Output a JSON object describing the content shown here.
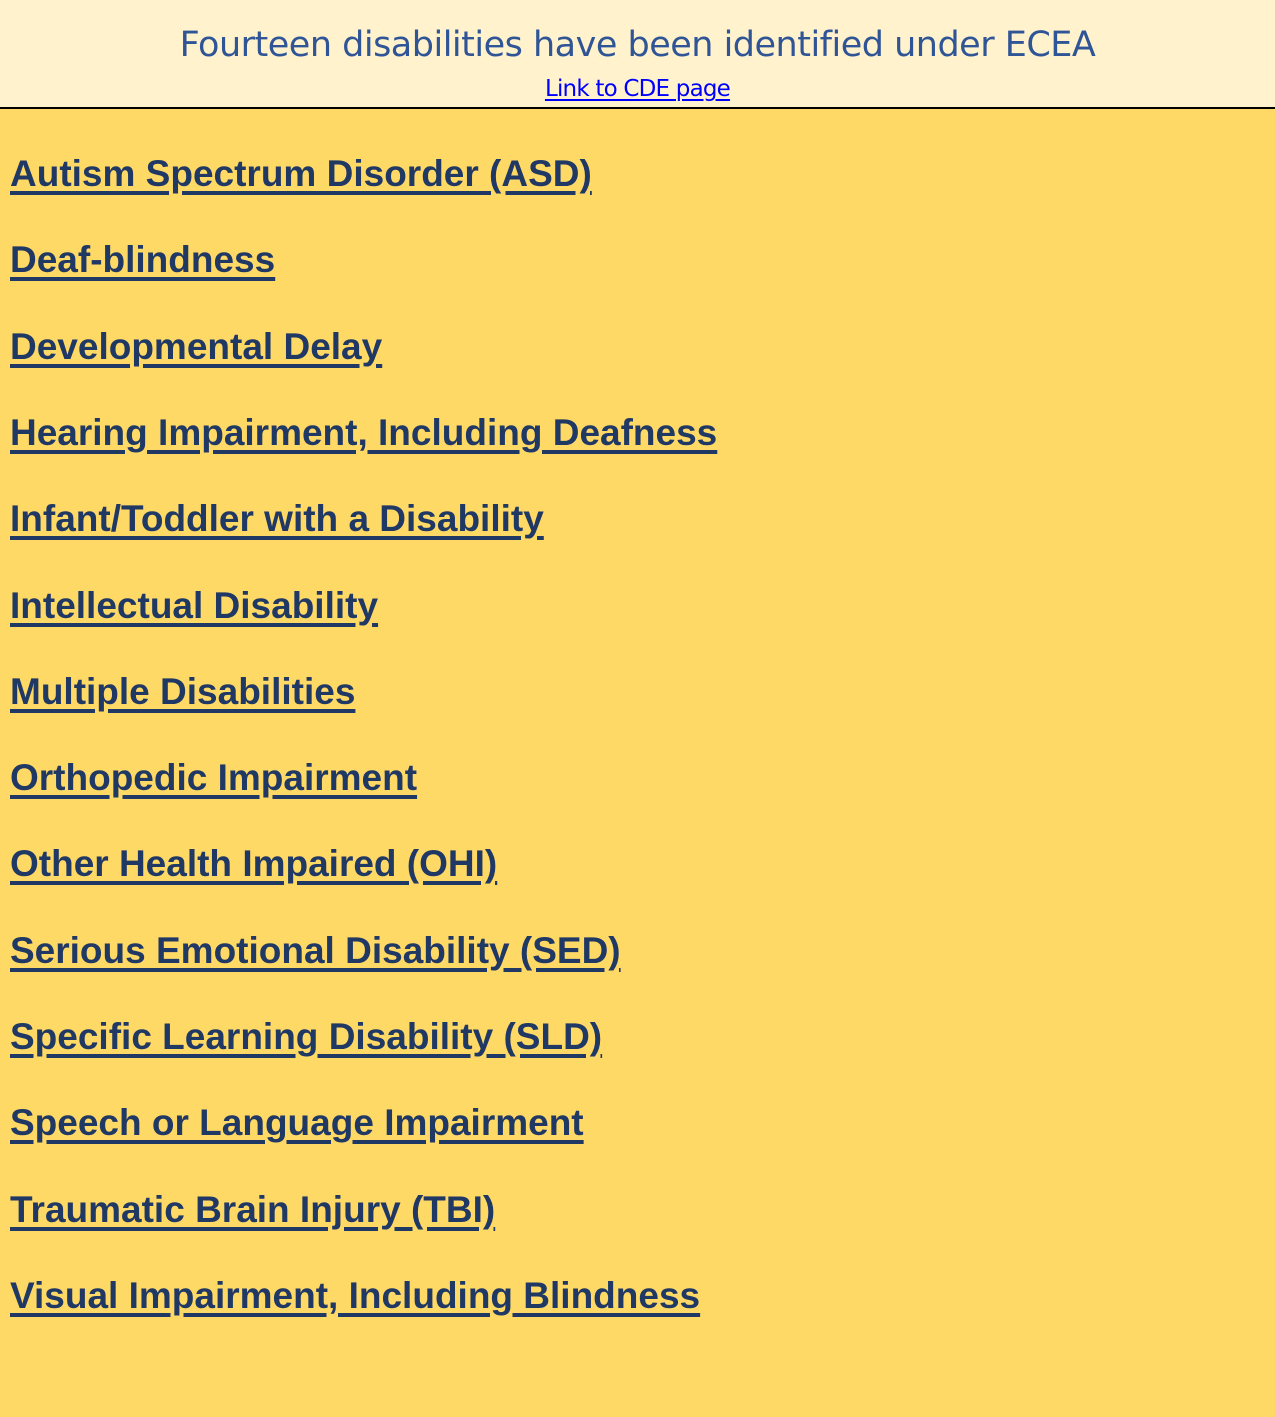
{
  "header": {
    "title": "Fourteen disabilities have been identified under ECEA",
    "link_label": "Link to CDE page"
  },
  "colors": {
    "header_background": "#FFF2CC",
    "body_background": "#FFD966",
    "title_text": "#2F5597",
    "header_link": "#0000FF",
    "item_link": "#203864",
    "divider": "#000000"
  },
  "disabilities": [
    {
      "label": "Autism Spectrum Disorder (ASD)"
    },
    {
      "label": "Deaf-blindness"
    },
    {
      "label": "Developmental Delay"
    },
    {
      "label": "Hearing Impairment, Including Deafness"
    },
    {
      "label": "Infant/Toddler with a Disability"
    },
    {
      "label": "Intellectual Disability"
    },
    {
      "label": "Multiple Disabilities"
    },
    {
      "label": "Orthopedic Impairment"
    },
    {
      "label": "Other Health Impaired (OHI)"
    },
    {
      "label": "Serious Emotional Disability (SED)"
    },
    {
      "label": "Specific Learning Disability (SLD)"
    },
    {
      "label": "Speech or Language Impairment"
    },
    {
      "label": "Traumatic Brain Injury (TBI)"
    },
    {
      "label": "Visual Impairment, Including Blindness"
    }
  ]
}
